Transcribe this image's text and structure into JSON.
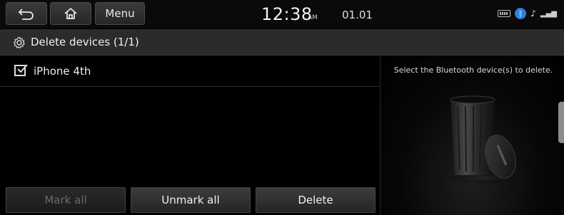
{
  "statusbar": {
    "back_icon": "back-arrow-icon",
    "home_icon": "home-icon",
    "menu_label": "Menu",
    "time": "12:38",
    "ampm": "AM",
    "date": "01.01",
    "bluetooth_color": "#2f7fe0"
  },
  "title": {
    "icon": "gear-icon",
    "text": "Delete devices (1/1)"
  },
  "devices": [
    {
      "name": "iPhone 4th",
      "checked": true
    }
  ],
  "buttons": {
    "mark_all": "Mark all",
    "unmark_all": "Unmark all",
    "delete": "Delete"
  },
  "info": {
    "text": "Select the Bluetooth device(s) to delete.",
    "icon": "trash-bin-icon"
  }
}
